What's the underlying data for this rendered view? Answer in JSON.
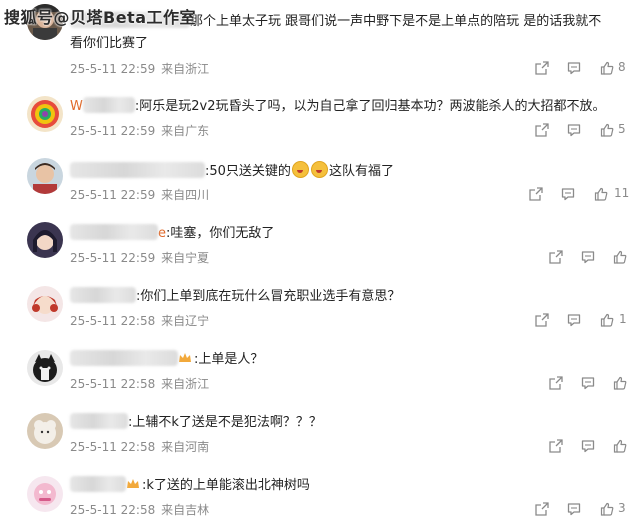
{
  "watermark": "搜狐号@贝塔Beta工作室",
  "comments": [
    {
      "text_line1": "那个上单太子玩 跟哥们说一声中野下是不是上单点的陪玩 是的话我就不",
      "text_line2": "看你们比赛了",
      "date": "25-5-11 22:59",
      "location": "来自浙江",
      "likes": "8"
    },
    {
      "username_fragment": "W",
      "text": ":阿乐是玩2v2玩昏头了吗，以为自己拿了回归基本功？两波能杀人的大招都不放。",
      "date": "25-5-11 22:59",
      "location": "来自广东",
      "likes": "5"
    },
    {
      "text_pre": ":50只送关键的",
      "text_post": "这队有福了",
      "date": "25-5-11 22:59",
      "location": "来自四川",
      "likes": "11"
    },
    {
      "username_fragment": "e",
      "text": ":哇塞，你们无敌了",
      "date": "25-5-11 22:59",
      "location": "来自宁夏",
      "likes": ""
    },
    {
      "text": ":你们上单到底在玩什么冒充职业选手有意思？",
      "date": "25-5-11 22:58",
      "location": "来自辽宁",
      "likes": "1"
    },
    {
      "text": ":上单是人？",
      "date": "25-5-11 22:58",
      "location": "来自浙江",
      "likes": ""
    },
    {
      "text": ":上辅不k了送是不是犯法啊？？？",
      "date": "25-5-11 22:58",
      "location": "来自河南",
      "likes": ""
    },
    {
      "text": ":k了送的上单能滚出北神树吗",
      "date": "25-5-11 22:58",
      "location": "来自吉林",
      "likes": "3"
    }
  ],
  "icons": {
    "share": "share-icon",
    "comment": "comment-icon",
    "like": "thumbs-up-icon"
  }
}
